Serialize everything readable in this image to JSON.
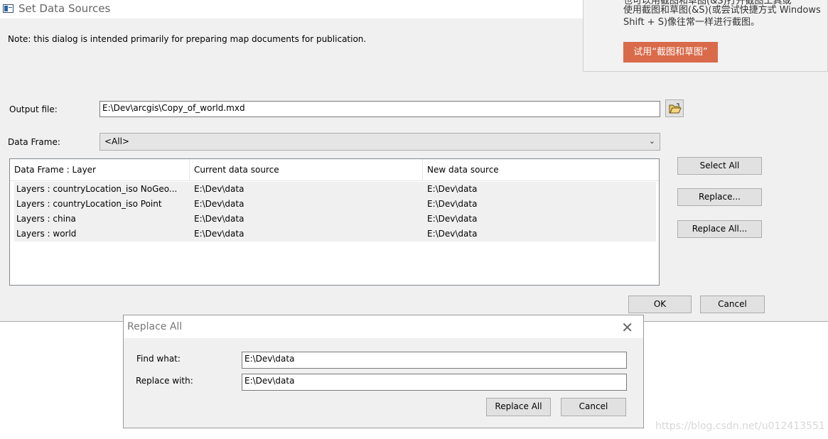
{
  "window": {
    "title": "Set Data Sources",
    "note": "Note: this dialog is intended primarily for preparing map documents for publication."
  },
  "output_file": {
    "label": "Output file:",
    "value": "E:\\Dev\\arcgis\\Copy_of_world.mxd",
    "browse_icon": "folder-open-icon"
  },
  "data_frame": {
    "label": "Data Frame:",
    "selected": "<All>"
  },
  "table": {
    "columns": [
      "Data Frame : Layer",
      "Current data source",
      "New data source"
    ],
    "rows": [
      [
        "Layers : countryLocation_iso NoGeo...",
        "E:\\Dev\\data",
        "E:\\Dev\\data"
      ],
      [
        "Layers : countryLocation_iso Point",
        "E:\\Dev\\data",
        "E:\\Dev\\data"
      ],
      [
        "Layers : china",
        "E:\\Dev\\data",
        "E:\\Dev\\data"
      ],
      [
        "Layers : world",
        "E:\\Dev\\data",
        "E:\\Dev\\data"
      ]
    ]
  },
  "buttons": {
    "select_all": "Select All",
    "replace": "Replace...",
    "replace_all": "Replace All...",
    "ok": "OK",
    "cancel": "Cancel"
  },
  "toast": {
    "line0": "也可以用截图和草图(&S)打开截图工具或",
    "line1": "使用截图和草图(&S)(或尝试快捷方式 Windows",
    "line2": "Shift + S)像往常一样进行截图。",
    "button": "试用“截图和草图”"
  },
  "replace_dialog": {
    "title": "Replace All",
    "find_label": "Find what:",
    "find_value": "E:\\Dev\\data",
    "replace_label": "Replace with:",
    "replace_value": "E:\\Dev\\data",
    "replace_all_button": "Replace All",
    "cancel_button": "Cancel",
    "close_icon": "close-icon"
  },
  "watermark": "https://blog.csdn.net/u012413551"
}
